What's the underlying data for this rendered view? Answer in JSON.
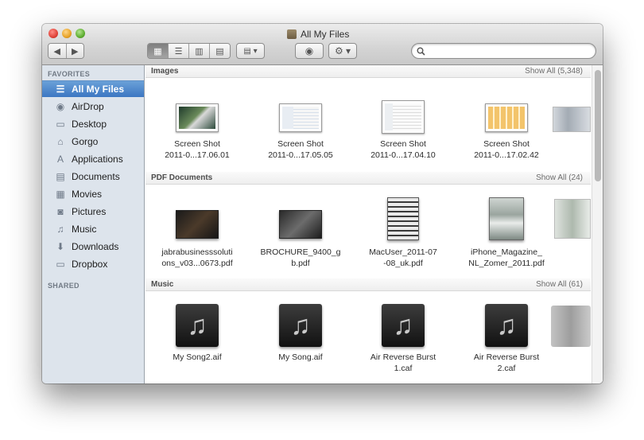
{
  "window": {
    "title": "All My Files"
  },
  "search": {
    "placeholder": "",
    "value": ""
  },
  "sidebar": {
    "favorites_header": "FAVORITES",
    "shared_header": "SHARED",
    "items": [
      {
        "label": "All My Files",
        "icon": "all-files-icon",
        "glyph": "☰"
      },
      {
        "label": "AirDrop",
        "icon": "airdrop-icon",
        "glyph": "◉"
      },
      {
        "label": "Desktop",
        "icon": "desktop-icon",
        "glyph": "▭"
      },
      {
        "label": "Gorgo",
        "icon": "home-icon",
        "glyph": "⌂"
      },
      {
        "label": "Applications",
        "icon": "applications-icon",
        "glyph": "A"
      },
      {
        "label": "Documents",
        "icon": "documents-icon",
        "glyph": "▤"
      },
      {
        "label": "Movies",
        "icon": "movies-icon",
        "glyph": "▦"
      },
      {
        "label": "Pictures",
        "icon": "pictures-icon",
        "glyph": "◙"
      },
      {
        "label": "Music",
        "icon": "music-icon",
        "glyph": "♫"
      },
      {
        "label": "Downloads",
        "icon": "downloads-icon",
        "glyph": "⬇"
      },
      {
        "label": "Dropbox",
        "icon": "dropbox-icon",
        "glyph": "▭"
      }
    ]
  },
  "sections": {
    "images": {
      "title": "Images",
      "show_all": "Show All (5,348)",
      "items": [
        {
          "line1": "Screen Shot",
          "line2": "2011-0...17.06.01"
        },
        {
          "line1": "Screen Shot",
          "line2": "2011-0...17.05.05"
        },
        {
          "line1": "Screen Shot",
          "line2": "2011-0...17.04.10"
        },
        {
          "line1": "Screen Shot",
          "line2": "2011-0...17.02.42"
        }
      ]
    },
    "pdf": {
      "title": "PDF Documents",
      "show_all": "Show All (24)",
      "items": [
        {
          "line1": "jabrabusinesssoluti",
          "line2": "ons_v03...0673.pdf"
        },
        {
          "line1": "BROCHURE_9400_g",
          "line2": "b.pdf"
        },
        {
          "line1": "MacUser_2011-07",
          "line2": "-08_uk.pdf"
        },
        {
          "line1": "iPhone_Magazine_",
          "line2": "NL_Zomer_2011.pdf"
        }
      ]
    },
    "music": {
      "title": "Music",
      "show_all": "Show All (61)",
      "items": [
        {
          "line1": "My Song2.aif",
          "line2": ""
        },
        {
          "line1": "My Song.aif",
          "line2": ""
        },
        {
          "line1": "Air Reverse Burst",
          "line2": "1.caf"
        },
        {
          "line1": "Air Reverse Burst",
          "line2": "2.caf"
        }
      ]
    }
  }
}
